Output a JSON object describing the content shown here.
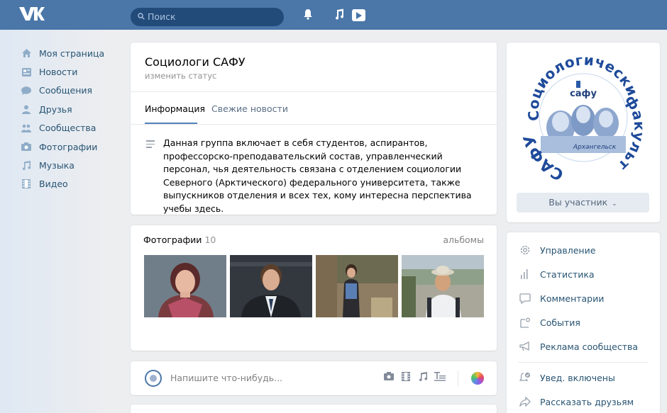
{
  "header": {
    "logo": "VK",
    "search_placeholder": "Поиск",
    "icons": [
      "bell-icon",
      "music-icon",
      "video-play-icon"
    ]
  },
  "nav": {
    "items": [
      {
        "label": "Моя страница",
        "icon": "home-icon"
      },
      {
        "label": "Новости",
        "icon": "news-icon"
      },
      {
        "label": "Сообщения",
        "icon": "messages-icon"
      },
      {
        "label": "Друзья",
        "icon": "friends-icon"
      },
      {
        "label": "Сообщества",
        "icon": "communities-icon"
      },
      {
        "label": "Фотографии",
        "icon": "camera-icon"
      },
      {
        "label": "Музыка",
        "icon": "music-icon"
      },
      {
        "label": "Видео",
        "icon": "video-icon"
      }
    ]
  },
  "group": {
    "title": "Социологи САФУ",
    "status": "изменить статус",
    "tabs": [
      "Информация",
      "Свежие новости"
    ],
    "description": "Данная группа включает в себя студентов, аспирантов, профессорско-преподавательский состав, управленческий персонал, чья деятельность связана с отделением социологии Северного (Арктического) федерального университета, также выпускников отделения и всех тех, кому интересна перспектива учебы здесь."
  },
  "photos": {
    "title": "Фотографии",
    "count": "10",
    "albums_link": "альбомы"
  },
  "composer": {
    "placeholder": "Напишите что-нибудь..."
  },
  "emblem": {
    "ring_text_top": "Социологический",
    "ring_text_left": "САФУ",
    "ring_text_right": "факультет",
    "inner_top": "сафу",
    "inner_bottom": "Архангельск"
  },
  "member_button": "Вы участник",
  "side_menu": {
    "items": [
      {
        "label": "Управление",
        "icon": "gear-icon"
      },
      {
        "label": "Статистика",
        "icon": "stats-icon"
      },
      {
        "label": "Комментарии",
        "icon": "comment-icon"
      },
      {
        "label": "События",
        "icon": "events-icon"
      },
      {
        "label": "Реклама сообщества",
        "icon": "megaphone-icon"
      },
      {
        "label": "Увед. включены",
        "icon": "notifications-on-icon"
      },
      {
        "label": "Рассказать друзьям",
        "icon": "share-icon"
      }
    ]
  },
  "colors": {
    "header": "#4a76a8",
    "link": "#285473",
    "background": "#edeef0"
  }
}
